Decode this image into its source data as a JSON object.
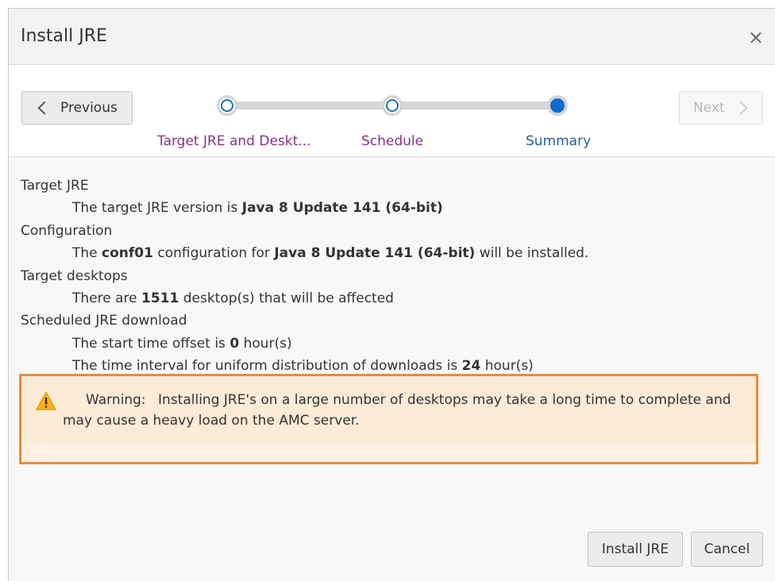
{
  "dialog": {
    "title": "Install JRE",
    "close_glyph": "×"
  },
  "train": {
    "previous_label": "Previous",
    "next_label": "Next",
    "steps": [
      {
        "label": "Target JRE and Deskt...",
        "state": "visited"
      },
      {
        "label": "Schedule",
        "state": "visited"
      },
      {
        "label": "Summary",
        "state": "current"
      }
    ]
  },
  "summary": {
    "target_jre_heading": "Target JRE",
    "target_jre_prefix": "The target JRE version is ",
    "target_jre_version": "Java 8 Update 141 (64-bit)",
    "configuration_heading": "Configuration",
    "config_prefix": "The ",
    "config_name": "conf01",
    "config_middle": " configuration for ",
    "config_version": "Java 8 Update 141 (64-bit)",
    "config_suffix": " will be installed.",
    "desktops_heading": "Target desktops",
    "desktops_prefix": "There are ",
    "desktops_count": "1511",
    "desktops_suffix": " desktop(s) that will be affected",
    "download_heading": "Scheduled JRE download",
    "offset_prefix": "The start time offset is ",
    "offset_value": "0",
    "offset_suffix": " hour(s)",
    "interval_prefix": "The time interval for uniform distribution of downloads is ",
    "interval_value": "24",
    "interval_suffix": " hour(s)"
  },
  "warning": {
    "title": "Warning:",
    "line1": "Installing JRE's on a large number of desktops may take a long time to complete and",
    "line2": "may cause a heavy load on the AMC server.",
    "icon": "warning-triangle-icon",
    "highlight_color": "#f28a2e"
  },
  "footer": {
    "install_label": "Install JRE",
    "cancel_label": "Cancel"
  },
  "colors": {
    "visited_step": "#8a2e8a",
    "current_step": "#1d5f99",
    "current_dot": "#0a6dcc"
  }
}
